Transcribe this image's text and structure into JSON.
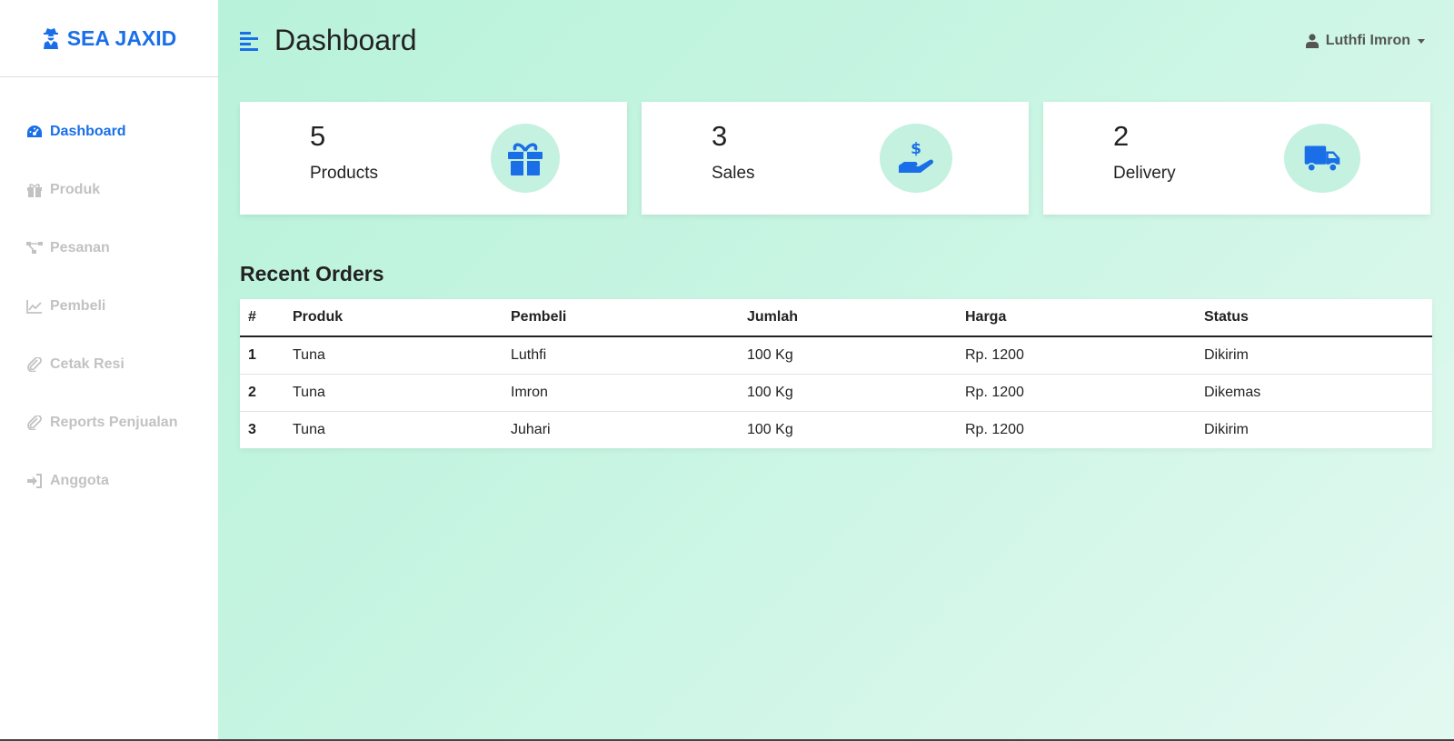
{
  "brand": {
    "name": "SEA JAXID",
    "icon": "user-secret-icon",
    "color": "#1a6fe8"
  },
  "sidebar": {
    "items": [
      {
        "label": "Dashboard",
        "icon": "gauge-icon",
        "active": true
      },
      {
        "label": "Produk",
        "icon": "gift-icon",
        "active": false
      },
      {
        "label": "Pesanan",
        "icon": "sitemap-icon",
        "active": false
      },
      {
        "label": "Pembeli",
        "icon": "chart-line-icon",
        "active": false
      },
      {
        "label": "Cetak Resi",
        "icon": "paperclip-icon",
        "active": false
      },
      {
        "label": "Reports Penjualan",
        "icon": "paperclip-icon",
        "active": false
      },
      {
        "label": "Anggota",
        "icon": "sign-in-icon",
        "active": false
      }
    ]
  },
  "header": {
    "title": "Dashboard",
    "user_name": "Luthfi Imron"
  },
  "cards": [
    {
      "value": "5",
      "label": "Products",
      "icon": "gift-icon"
    },
    {
      "value": "3",
      "label": "Sales",
      "icon": "hand-holding-dollar-icon"
    },
    {
      "value": "2",
      "label": "Delivery",
      "icon": "truck-icon"
    }
  ],
  "orders": {
    "title": "Recent Orders",
    "columns": [
      "#",
      "Produk",
      "Pembeli",
      "Jumlah",
      "Harga",
      "Status"
    ],
    "rows": [
      [
        "1",
        "Tuna",
        "Luthfi",
        "100 Kg",
        "Rp. 1200",
        "Dikirim"
      ],
      [
        "2",
        "Tuna",
        "Imron",
        "100 Kg",
        "Rp. 1200",
        "Dikemas"
      ],
      [
        "3",
        "Tuna",
        "Juhari",
        "100 Kg",
        "Rp. 1200",
        "Dikirim"
      ]
    ]
  },
  "colors": {
    "accent": "#1a6fe8",
    "muted": "#c2c2c2",
    "icon_bg": "#c4f1e0"
  }
}
